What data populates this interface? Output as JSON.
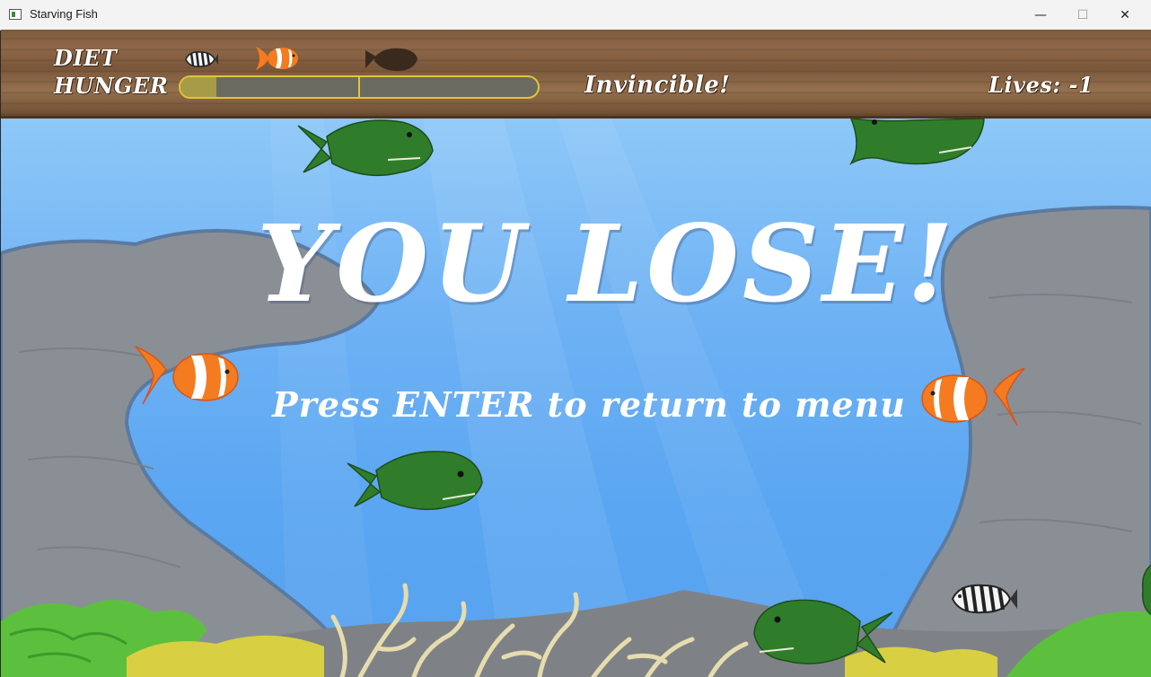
{
  "window": {
    "title": "Starving Fish",
    "minimize_glyph": "—",
    "maximize_glyph": "☐",
    "close_glyph": "✕"
  },
  "hud": {
    "diet_label": "DIET",
    "hunger_label": "HUNGER",
    "status_text": "Invincible!",
    "lives_text": "Lives: -1",
    "hunger_level": 0.1,
    "diet_icons": [
      "striped-fish-icon",
      "clownfish-icon",
      "dark-fish-silhouette-icon"
    ]
  },
  "game": {
    "headline": "YOU LOSE!",
    "prompt": "Press ENTER to return to menu"
  },
  "colors": {
    "water": "#6fb2f4",
    "wood": "#7d5a3c",
    "hunger_bar_border": "#e4c23c",
    "piranha": "#2f7d2a",
    "clownfish": "#f47b20"
  }
}
